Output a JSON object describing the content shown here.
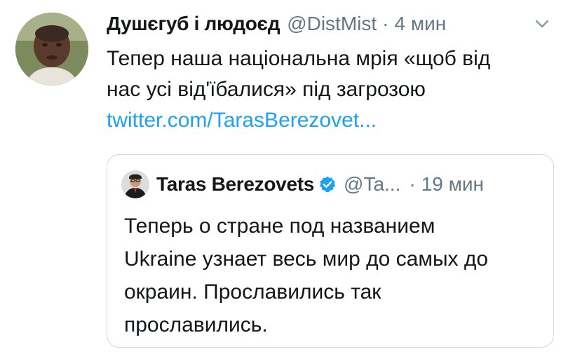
{
  "tweet": {
    "author_name": "Душєгуб і людоєд",
    "author_handle": "@DistMist",
    "separator": "·",
    "time": "4 мин",
    "avatar_icon": "user-avatar-photo",
    "caret_icon": "chevron-down-icon",
    "text_lines": [
      "Тепер наша національна мрія «щоб від",
      "нас усі від'їбалися» під загрозою"
    ],
    "link_text": "twitter.com/TarasBerezovet..."
  },
  "quoted_tweet": {
    "author_name": "Taras Berezovets",
    "verified_icon": "verified-badge-icon",
    "author_handle": "@Ta...",
    "separator": "·",
    "time": "19 мин",
    "text_lines": [
      "Теперь о стране под названием",
      "Ukraine узнает весь мир до самых до",
      "окраин. Прославились так",
      "прославились."
    ]
  },
  "colors": {
    "text": "#14171a",
    "secondary": "#657786",
    "link": "#1da1f2",
    "border": "#cfd9de"
  }
}
